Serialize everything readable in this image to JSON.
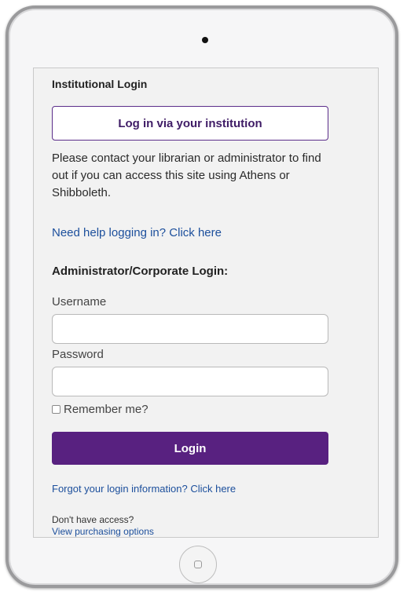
{
  "institutional": {
    "title": "Institutional Login",
    "button_label": "Log in via your institution",
    "info": "Please contact your librarian or administrator to find out if you can access this site using Athens or Shibboleth.",
    "help_link": "Need help logging in? Click here"
  },
  "admin": {
    "title": "Administrator/Corporate Login:",
    "username_label": "Username",
    "username_value": "",
    "password_label": "Password",
    "password_value": "",
    "remember_label": "Remember me?",
    "login_label": "Login",
    "forgot_link": "Forgot your login information? Click here"
  },
  "access": {
    "text": "Don't have access?",
    "link": "View purchasing options"
  },
  "colors": {
    "accent": "#582180",
    "link": "#1c4f9c"
  }
}
